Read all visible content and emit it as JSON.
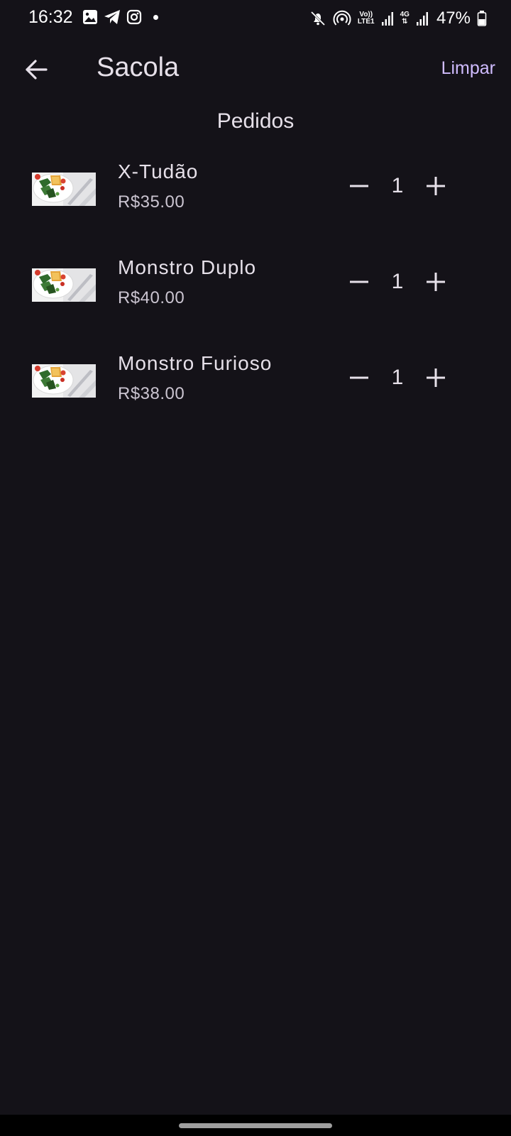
{
  "status_bar": {
    "time": "16:32",
    "left_icons": [
      "image-icon",
      "telegram-icon",
      "instagram-icon",
      "notification-dot-icon"
    ],
    "right_icons": [
      "mute-icon",
      "hotspot-icon",
      "volte-icon",
      "signal-icon",
      "signal-icon"
    ],
    "volte_label_top": "Vo))",
    "volte_label_bottom": "LTE1",
    "network_label": "4G",
    "battery": "47%"
  },
  "app_bar": {
    "title": "Sacola",
    "clear_label": "Limpar",
    "back_icon": "arrow-back-icon"
  },
  "section": {
    "title": "Pedidos"
  },
  "items": [
    {
      "name": "X-Tudão",
      "price": "R$35.00",
      "quantity": "1"
    },
    {
      "name": "Monstro Duplo",
      "price": "R$40.00",
      "quantity": "1"
    },
    {
      "name": "Monstro Furioso",
      "price": "R$38.00",
      "quantity": "1"
    }
  ],
  "colors": {
    "background": "#141218",
    "text_primary": "#e6e0e9",
    "text_secondary": "#cac4d0",
    "accent": "#d0bcff"
  }
}
